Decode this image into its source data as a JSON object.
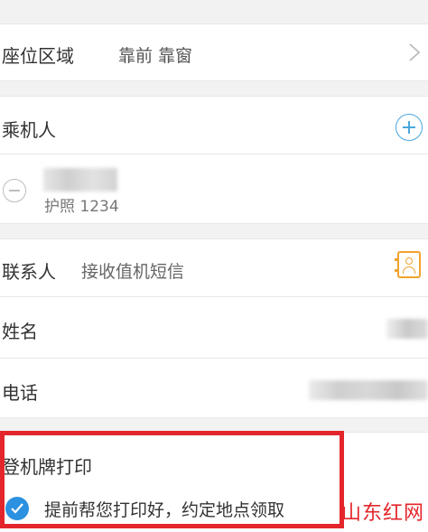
{
  "seat": {
    "label": "座位区域",
    "value": "靠前 靠窗",
    "icon": "chevron-right-icon"
  },
  "passenger": {
    "label": "乘机人",
    "add_icon": "add-circle-icon",
    "remove_icon": "remove-circle-icon",
    "passport": "护照 1234"
  },
  "contact": {
    "label": "联系人",
    "hint": "接收值机短信",
    "icon": "contact-book-icon",
    "name_label": "姓名",
    "phone_label": "电话"
  },
  "boarding": {
    "title": "登机牌打印",
    "option": "提前帮您打印好，约定地点领取",
    "checked": true
  },
  "watermark": "山东红网",
  "colors": {
    "accent_blue": "#2b91e0",
    "contact_orange": "#f0a22f",
    "highlight_red": "#e3262b"
  }
}
